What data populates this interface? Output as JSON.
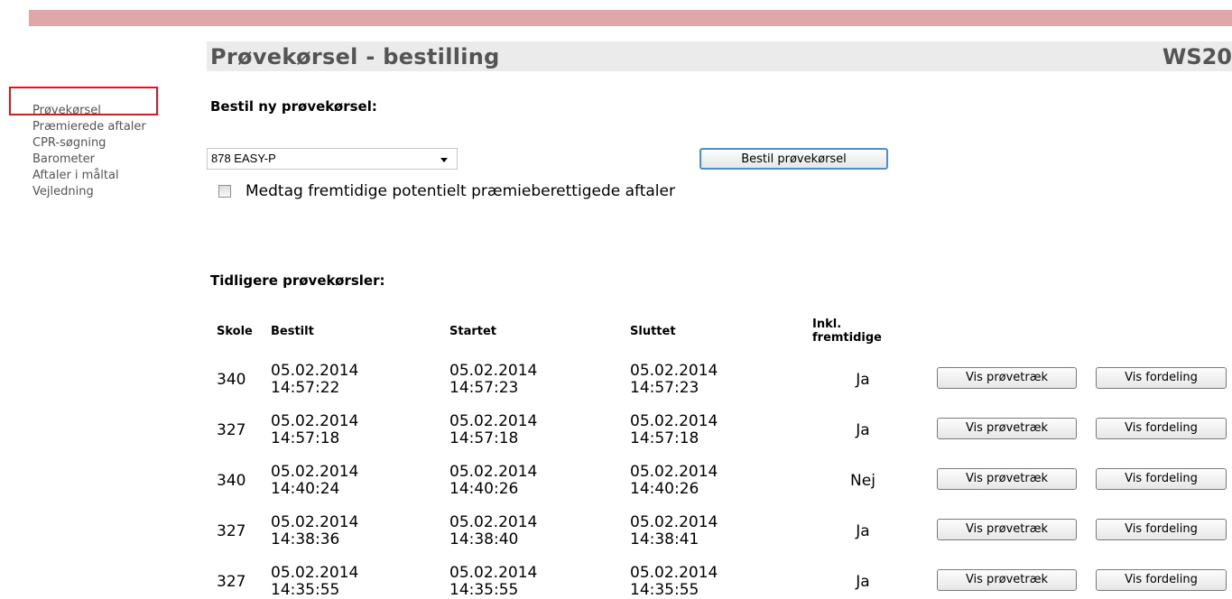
{
  "header": {
    "title": "Prøvekørsel - bestilling",
    "code": "WS20"
  },
  "sidebar": {
    "items": [
      {
        "label": "Prøvekørsel"
      },
      {
        "label": "Præmierede aftaler"
      },
      {
        "label": "CPR-søgning"
      },
      {
        "label": "Barometer"
      },
      {
        "label": "Aftaler i måltal"
      },
      {
        "label": "Vejledning"
      }
    ],
    "highlight_color": "#e0141e"
  },
  "order": {
    "heading": "Bestil ny prøvekørsel:",
    "select_value": "878 EASY-P",
    "button_label": "Bestil prøvekørsel",
    "checkbox_label": "Medtag fremtidige potentielt præmieberettigede aftaler",
    "checkbox_checked": false
  },
  "history": {
    "heading": "Tidligere prøvekørsler:",
    "columns": {
      "school": "Skole",
      "ordered": "Bestilt",
      "started": "Startet",
      "ended": "Sluttet",
      "incl_line1": "Inkl.",
      "incl_line2": "fremtidige"
    },
    "rows": [
      {
        "school": "340",
        "ordered_date": "05.02.2014",
        "ordered_time": "14:57:22",
        "started_date": "05.02.2014",
        "started_time": "14:57:23",
        "ended_date": "05.02.2014",
        "ended_time": "14:57:23",
        "incl": "Ja",
        "sample_label": "Vis prøvetræk",
        "dist_label": "Vis fordeling"
      },
      {
        "school": "327",
        "ordered_date": "05.02.2014",
        "ordered_time": "14:57:18",
        "started_date": "05.02.2014",
        "started_time": "14:57:18",
        "ended_date": "05.02.2014",
        "ended_time": "14:57:18",
        "incl": "Ja",
        "sample_label": "Vis prøvetræk",
        "dist_label": "Vis fordeling"
      },
      {
        "school": "340",
        "ordered_date": "05.02.2014",
        "ordered_time": "14:40:24",
        "started_date": "05.02.2014",
        "started_time": "14:40:26",
        "ended_date": "05.02.2014",
        "ended_time": "14:40:26",
        "incl": "Nej",
        "sample_label": "Vis prøvetræk",
        "dist_label": "Vis fordeling"
      },
      {
        "school": "327",
        "ordered_date": "05.02.2014",
        "ordered_time": "14:38:36",
        "started_date": "05.02.2014",
        "started_time": "14:38:40",
        "ended_date": "05.02.2014",
        "ended_time": "14:38:41",
        "incl": "Ja",
        "sample_label": "Vis prøvetræk",
        "dist_label": "Vis fordeling"
      },
      {
        "school": "327",
        "ordered_date": "05.02.2014",
        "ordered_time": "14:35:55",
        "started_date": "05.02.2014",
        "started_time": "14:35:55",
        "ended_date": "05.02.2014",
        "ended_time": "14:35:55",
        "incl": "Ja",
        "sample_label": "Vis prøvetræk",
        "dist_label": "Vis fordeling"
      }
    ]
  },
  "colors": {
    "top_bar": "#dea8a8",
    "title_bar": "#ebebeb",
    "title_text": "#545454"
  }
}
